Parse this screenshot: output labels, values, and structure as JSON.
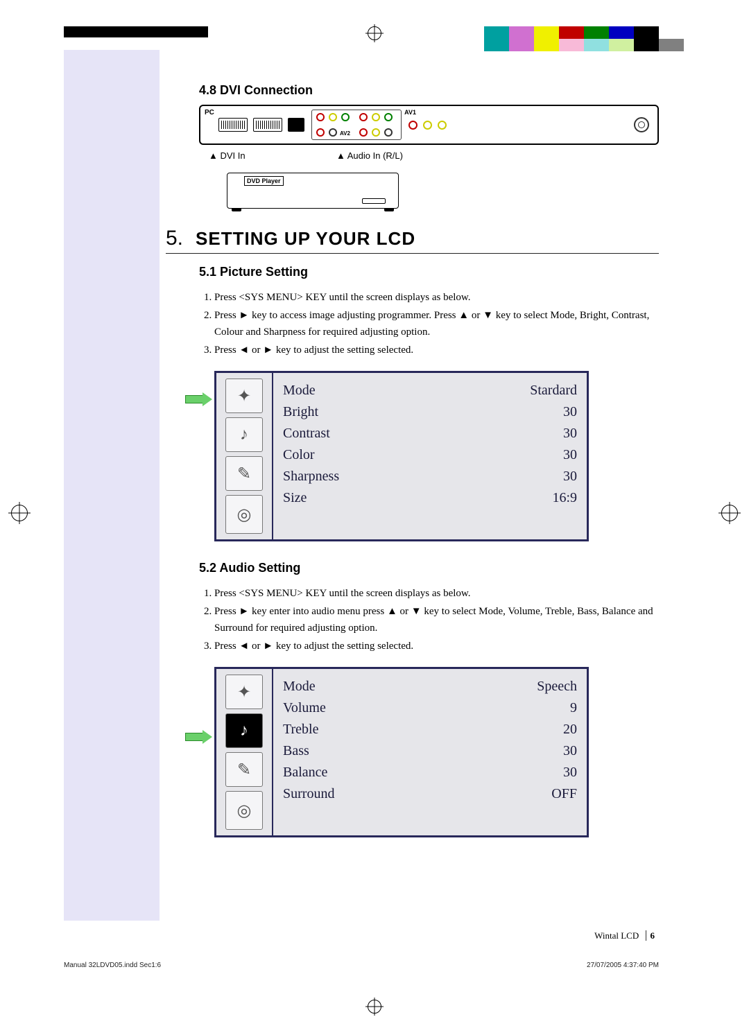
{
  "section48": {
    "title": "4.8  DVI Connection"
  },
  "connection": {
    "pc_label": "PC",
    "dvi_label": "▲ DVI In",
    "audio_label": "▲ Audio In (R/L)",
    "av1": "AV1",
    "av2": "AV2",
    "dvd_label": "DVD Player"
  },
  "chapter": {
    "num": "5.",
    "title": "SETTING UP YOUR LCD"
  },
  "section51": {
    "title": "5.1  Picture Setting",
    "steps": [
      "Press <SYS MENU> KEY until the screen displays as below.",
      "Press ► key to access image adjusting programmer. Press ▲ or ▼ key to select Mode, Bright, Contrast, Colour and Sharpness for required adjusting option.",
      "Press ◄ or ► key to adjust the setting selected."
    ],
    "osd": [
      {
        "label": "Mode",
        "value": "Stardard"
      },
      {
        "label": "Bright",
        "value": "30"
      },
      {
        "label": "Contrast",
        "value": "30"
      },
      {
        "label": "Color",
        "value": "30"
      },
      {
        "label": "Sharpness",
        "value": "30"
      },
      {
        "label": "Size",
        "value": "16:9"
      }
    ]
  },
  "section52": {
    "title": "5.2  Audio Setting",
    "steps": [
      "Press <SYS MENU> KEY until the screen displays as below.",
      "Press ► key enter into audio menu press ▲ or ▼ key to select Mode, Volume, Treble, Bass, Balance and Surround for required adjusting option.",
      "Press ◄ or ► key to adjust the setting selected."
    ],
    "osd": [
      {
        "label": "Mode",
        "value": "Speech"
      },
      {
        "label": "Volume",
        "value": "9"
      },
      {
        "label": "Treble",
        "value": "20"
      },
      {
        "label": "Bass",
        "value": "30"
      },
      {
        "label": "Balance",
        "value": "30"
      },
      {
        "label": "Surround",
        "value": "OFF"
      }
    ]
  },
  "footer": {
    "brand": "Wintal LCD",
    "page": "6",
    "file": "Manual 32LDVD05.indd   Sec1:6",
    "timestamp": "27/07/2005   4:37:40 PM"
  },
  "color_strip": [
    "#00a0a0",
    "#d070d0",
    "#f0f000",
    "#c00000",
    "#008000",
    "#0000c0",
    "#000000",
    "#ffffff",
    "#00a0a0",
    "#d070d0",
    "#f0f000",
    "#f8bad8",
    "#90e0e0",
    "#d0f0a0",
    "#000000",
    "#808080"
  ]
}
